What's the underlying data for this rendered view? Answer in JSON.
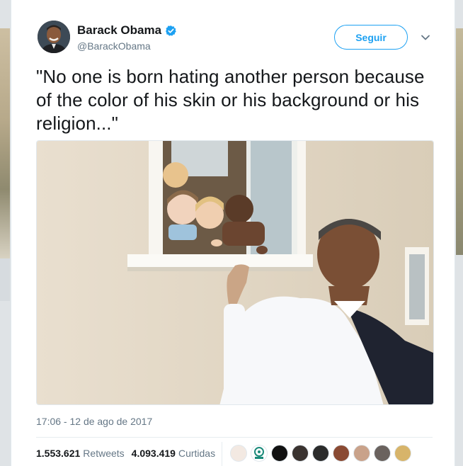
{
  "tweet": {
    "author_name": "Barack Obama",
    "author_handle": "@BarackObama",
    "follow_label": "Seguir",
    "text": "\"No one is born hating another person because of the color of his skin or his background or his religion...\"",
    "timestamp": "17:06 - 12 de ago de 2017",
    "retweets_count": "1.553.621",
    "retweets_label": "Retweets",
    "likes_count": "4.093.419",
    "likes_label": "Curtidas"
  },
  "icons": {
    "verified": "verified-badge-icon",
    "more": "chevron-down-icon"
  },
  "colors": {
    "accent": "#1da1f2",
    "muted": "#657786",
    "text": "#14171a"
  }
}
